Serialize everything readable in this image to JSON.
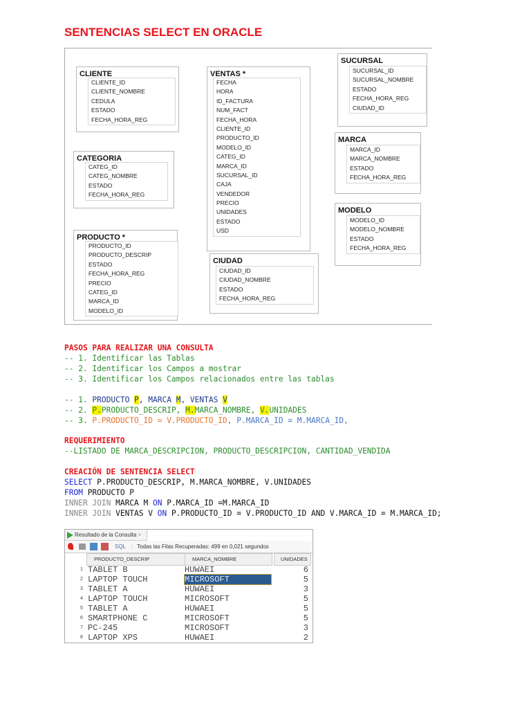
{
  "title": "SENTENCIAS SELECT EN ORACLE",
  "diagram": {
    "tables": [
      {
        "name": "CLIENTE",
        "fields": [
          "CLIENTE_ID",
          "CLIENTE_NOMBRE",
          "CEDULA",
          "ESTADO",
          "FECHA_HORA_REG"
        ]
      },
      {
        "name": "CATEGORIA",
        "fields": [
          "CATEG_ID",
          "CATEG_NOMBRE",
          "ESTADO",
          "FECHA_HORA_REG"
        ]
      },
      {
        "name": "PRODUCTO *",
        "fields": [
          "PRODUCTO_ID",
          "PRODUCTO_DESCRIP",
          "ESTADO",
          "FECHA_HORA_REG",
          "PRECIO",
          "CATEG_ID",
          "MARCA_ID",
          "MODELO_ID"
        ]
      },
      {
        "name": "VENTAS *",
        "fields": [
          "FECHA",
          "HORA",
          "ID_FACTURA",
          "NUM_FACT",
          "FECHA_HORA",
          "CLIENTE_ID",
          "PRODUCTO_ID",
          "MODELO_ID",
          "CATEG_ID",
          "MARCA_ID",
          "SUCURSAL_ID",
          "CAJA",
          "VENDEDOR",
          "PRECIO",
          "UNIDADES",
          "ESTADO",
          "USD"
        ]
      },
      {
        "name": "CIUDAD",
        "fields": [
          "CIUDAD_ID",
          "CIUDAD_NOMBRE",
          "ESTADO",
          "FECHA_HORA_REG"
        ]
      },
      {
        "name": "SUCURSAL",
        "fields": [
          "SUCURSAL_ID",
          "SUCURSAL_NOMBRE",
          "ESTADO",
          "FECHA_HORA_REG",
          "CIUDAD_ID"
        ]
      },
      {
        "name": "MARCA",
        "fields": [
          "MARCA_ID",
          "MARCA_NOMBRE",
          "ESTADO",
          "FECHA_HORA_REG"
        ]
      },
      {
        "name": "MODELO",
        "fields": [
          "MODELO_ID",
          "MODELO_NOMBRE",
          "ESTADO",
          "FECHA_HORA_REG"
        ]
      }
    ]
  },
  "steps": {
    "heading": "PASOS PARA REALIZAR UNA CONSULTA",
    "lines": [
      "-- 1. Identificar las Tablas",
      "-- 2. Identificar los Campos a mostrar",
      "-- 3. Identificar los Campos relacionados entre las tablas"
    ]
  },
  "applied": {
    "l1": {
      "prefix": "-- 1. ",
      "a": "PRODUCTO ",
      "ah": "P",
      "b": ", MARCA ",
      "bh": "M",
      "c": ", VENTAS ",
      "ch": "V"
    },
    "l2": {
      "prefix": "-- 2. ",
      "ah": "P.",
      "a": "PRODUCTO_DESCRIP, ",
      "bh": "M.",
      "b": "MARCA_NOMBRE, ",
      "ch": "V.",
      "c": "UNIDADES"
    },
    "l3": {
      "prefix": "-- 3. ",
      "a": "P.PRODUCTO_ID = V.PRODUCTO_ID",
      "sep": ", ",
      "b": "P.MARCA_ID = M.MARCA_ID,"
    }
  },
  "requirement": {
    "heading": "REQUERIMIENTO",
    "line": "--LISTADO DE MARCA_DESCRIPCION, PRODUCTO_DESCRIPCION, CANTIDAD_VENDIDA"
  },
  "sql": {
    "heading": "CREACIÓN DE SENTENCIA SELECT",
    "select_kw": "SELECT",
    "select_rest": " P.PRODUCTO_DESCRIP, M.MARCA_NOMBRE, V.UNIDADES",
    "from_kw": "FROM",
    "from_rest": " PRODUCTO P",
    "join1_kw": "INNER JOIN",
    "join1_a": " MARCA M ",
    "on1": "ON",
    "join1_b": " P.MARCA_ID =M.MARCA_ID",
    "join2_kw": "INNER JOIN",
    "join2_a": " VENTAS V ",
    "on2": "ON",
    "join2_b": " P.PRODUCTO_ID = V.PRODUCTO_ID AND V.MARCA_ID = M.MARCA_ID;"
  },
  "result": {
    "tab": "Resultado de la Consulta",
    "tab_close": "×",
    "sql_label": "SQL",
    "status": "Todas las Filas Recuperadas: 499 en 0,021 segundos",
    "columns": [
      "PRODUCTO_DESCRIP",
      "MARCA_NOMBRE",
      "UNIDADES"
    ],
    "rows": [
      [
        "1",
        "TABLET B",
        "HUWAEI",
        "6"
      ],
      [
        "2",
        "LAPTOP TOUCH",
        "MICROSOFT",
        "5"
      ],
      [
        "3",
        "TABLET A",
        "HUWAEI",
        "3"
      ],
      [
        "4",
        "LAPTOP TOUCH",
        "MICROSOFT",
        "5"
      ],
      [
        "5",
        "TABLET A",
        "HUWAEI",
        "5"
      ],
      [
        "6",
        "SMARTPHONE C",
        "MICROSOFT",
        "5"
      ],
      [
        "7",
        "PC-245",
        "MICROSOFT",
        "3"
      ],
      [
        "8",
        "LAPTOP XPS",
        "HUWAEI",
        "2"
      ]
    ],
    "selected_cell_color": "#2b5a8f"
  }
}
